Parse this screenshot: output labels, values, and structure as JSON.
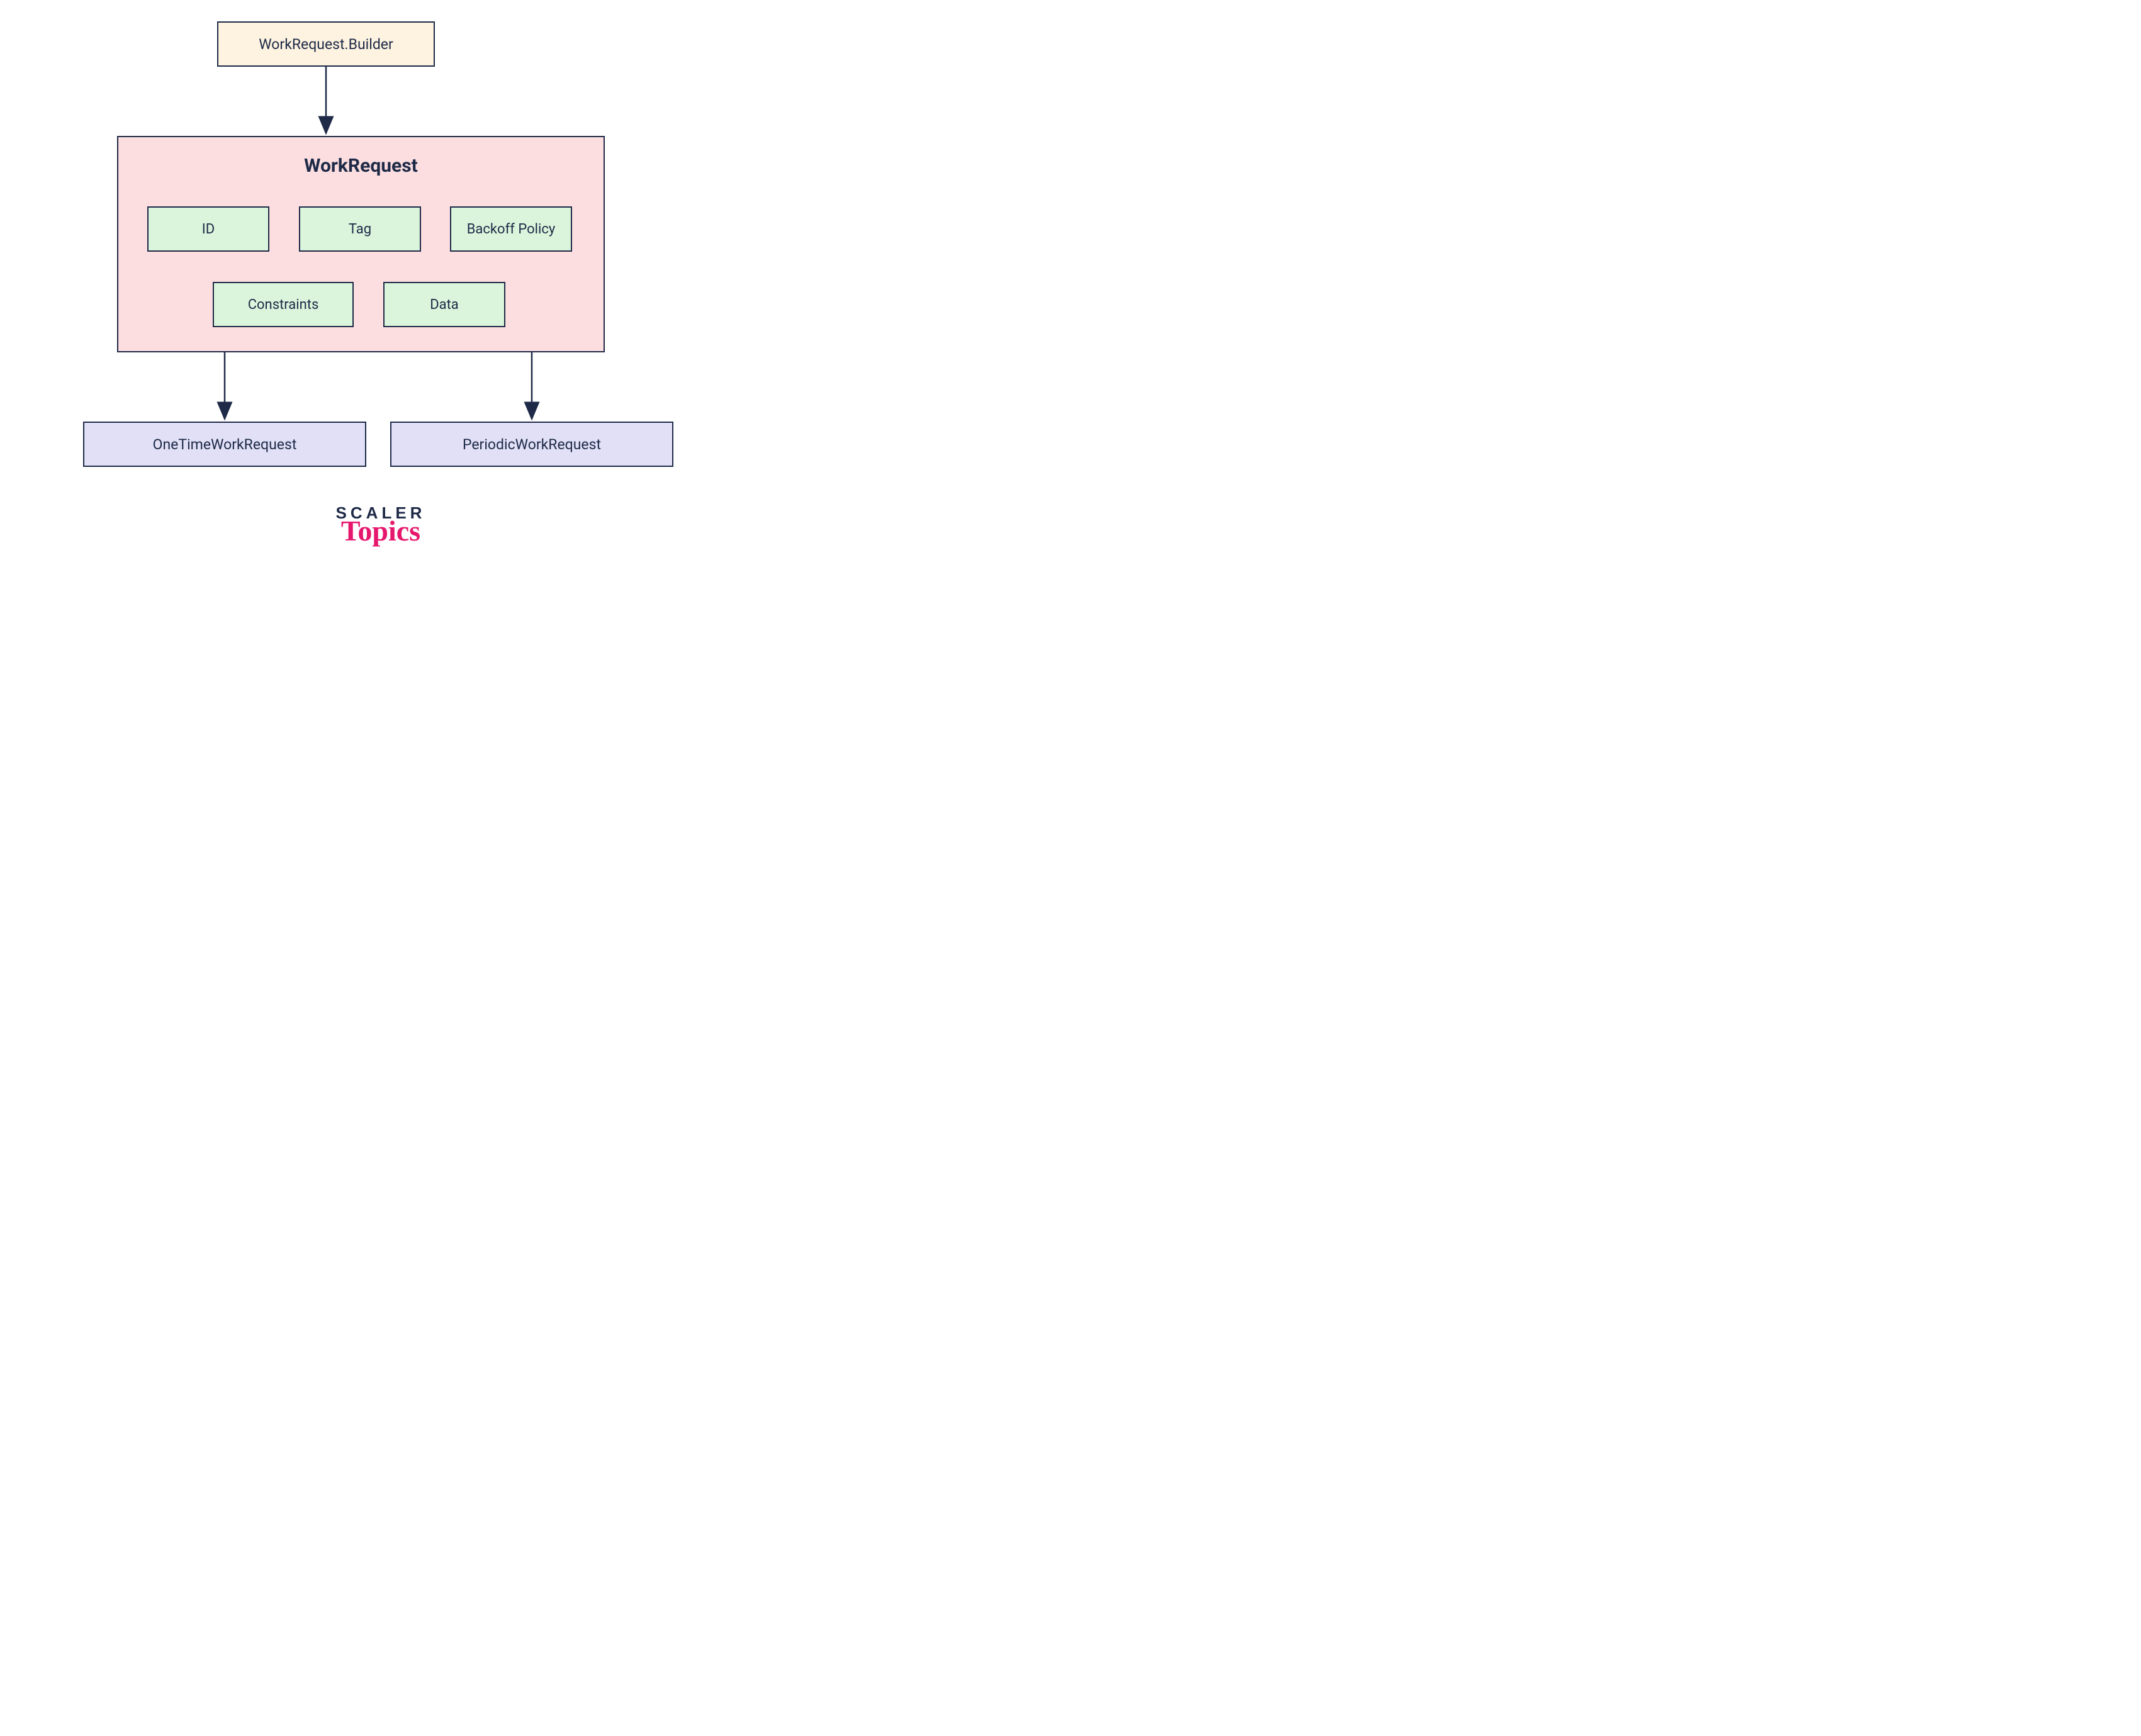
{
  "builder": {
    "label": "WorkRequest.Builder"
  },
  "main": {
    "title": "WorkRequest",
    "components": {
      "id": "ID",
      "tag": "Tag",
      "backoff": "Backoff Policy",
      "constraints": "Constraints",
      "data": "Data"
    }
  },
  "subclasses": {
    "onetime": "OneTimeWorkRequest",
    "periodic": "PeriodicWorkRequest"
  },
  "branding": {
    "line1": "SCALER",
    "line2": "Topics"
  },
  "colors": {
    "stroke": "#1e2a47",
    "builder_bg": "#fdf3e0",
    "main_bg": "#fcdee0",
    "component_bg": "#daf5db",
    "subclass_bg": "#e1e0f7",
    "brand_accent": "#e6186d"
  }
}
